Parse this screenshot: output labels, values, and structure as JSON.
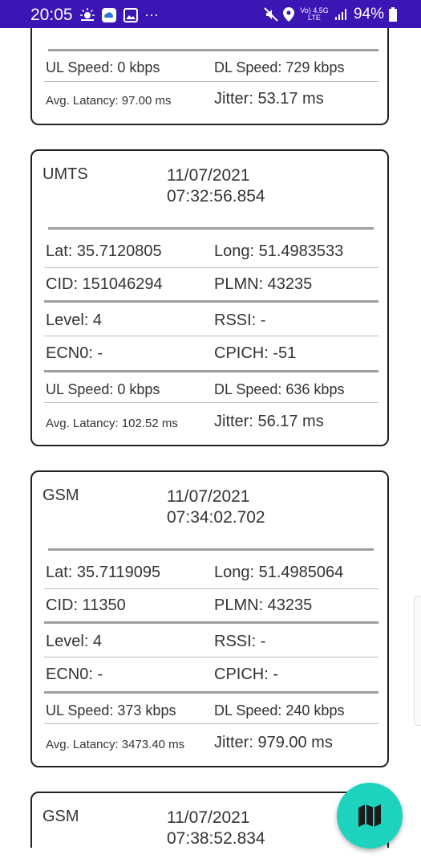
{
  "status_bar": {
    "time": "20:05",
    "network_label": "Vo) 4.5G LTE",
    "battery": "94%"
  },
  "cards": [
    {
      "partial_top": true,
      "ul_speed": "UL Speed: 0 kbps",
      "dl_speed": "DL Speed: 729 kbps",
      "avg_latency": "Avg. Latancy: 97.00 ms",
      "jitter": "Jitter: 53.17 ms"
    },
    {
      "tech": "UMTS",
      "date": "11/07/2021",
      "time": "07:32:56.854",
      "lat": "Lat: 35.7120805",
      "long": "Long: 51.4983533",
      "cid": "CID: 151046294",
      "plmn": "PLMN: 43235",
      "level": "Level: 4",
      "rssi": "RSSI: -",
      "ecn0": "ECN0: -",
      "cpich": "CPICH: -51",
      "ul_speed": "UL Speed: 0 kbps",
      "dl_speed": "DL Speed: 636 kbps",
      "avg_latency": "Avg. Latancy: 102.52 ms",
      "jitter": "Jitter: 56.17 ms"
    },
    {
      "tech": "GSM",
      "date": "11/07/2021",
      "time": "07:34:02.702",
      "lat": "Lat: 35.7119095",
      "long": "Long: 51.4985064",
      "cid": "CID: 11350",
      "plmn": "PLMN: 43235",
      "level": "Level: 4",
      "rssi": "RSSI: -",
      "ecn0": "ECN0: -",
      "cpich": "CPICH: -",
      "ul_speed": "UL Speed: 373 kbps",
      "dl_speed": "DL Speed: 240 kbps",
      "avg_latency": "Avg. Latancy: 3473.40 ms",
      "jitter": "Jitter: 979.00 ms"
    },
    {
      "tech": "GSM",
      "date": "11/07/2021",
      "time": "07:38:52.834"
    }
  ],
  "fab": {
    "icon": "map-icon"
  },
  "colors": {
    "status_bar": "#3b16b5",
    "fab": "#1dd3be",
    "card_border": "#222222"
  }
}
